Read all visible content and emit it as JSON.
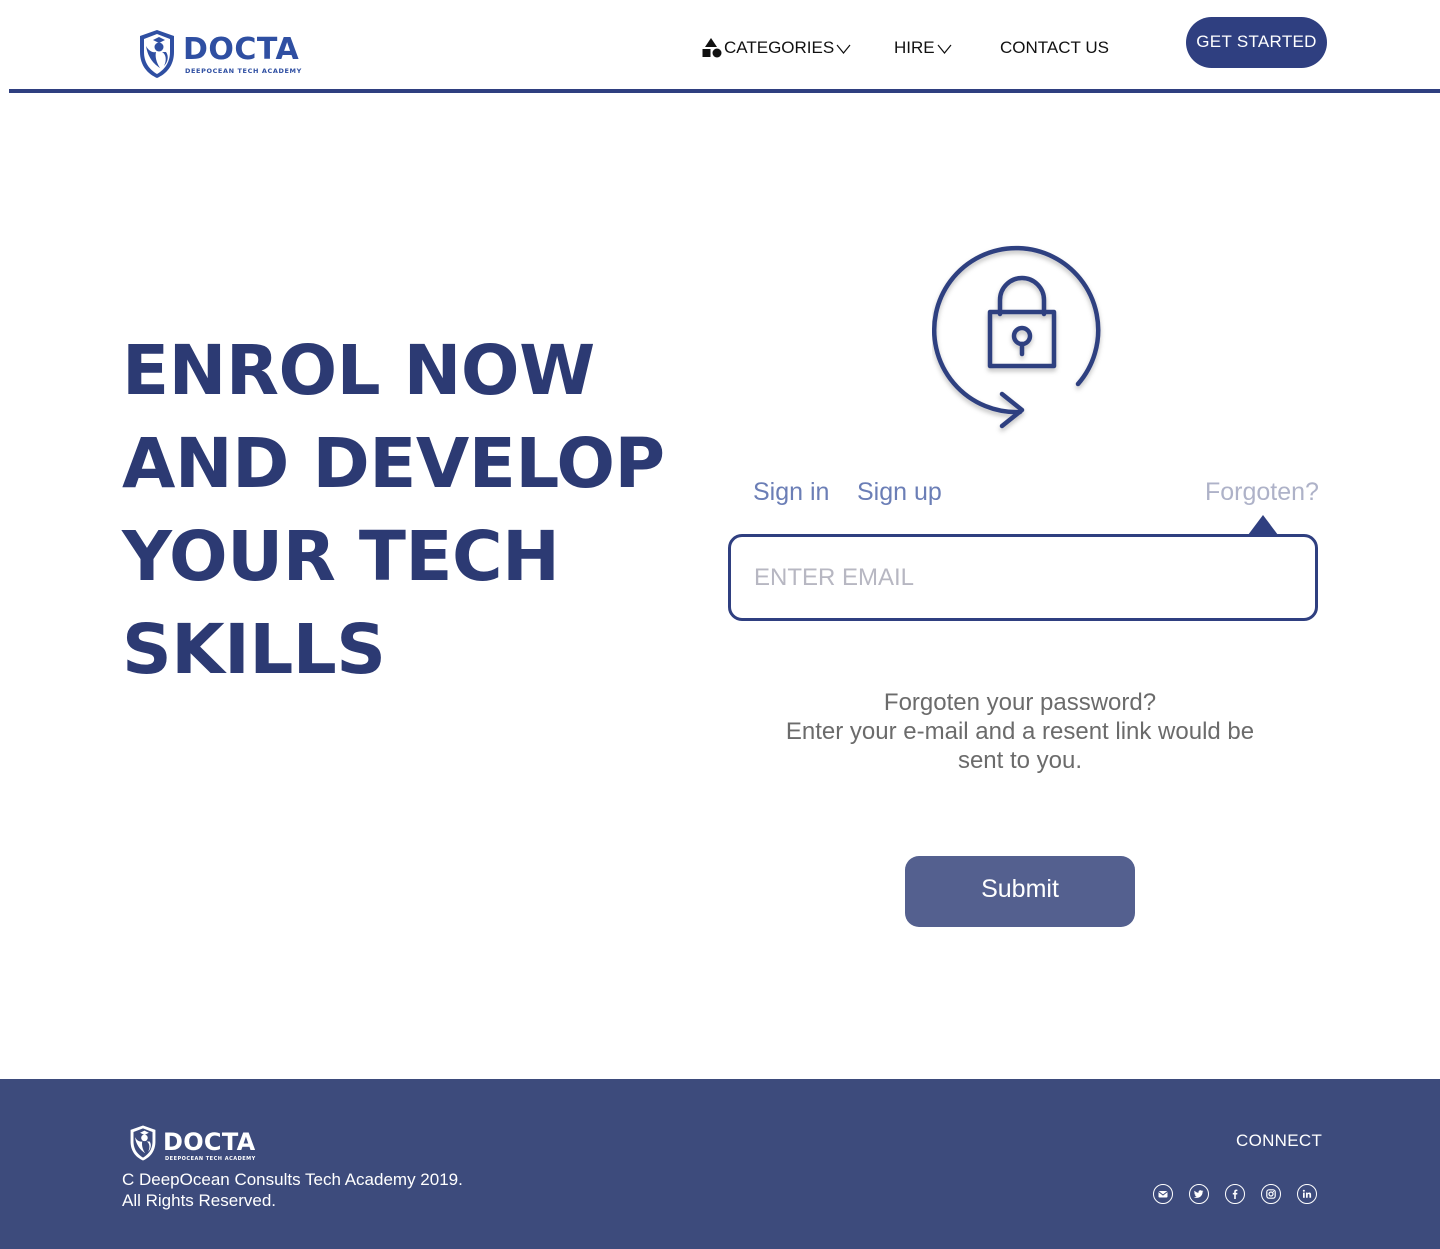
{
  "brand": {
    "name": "DOCTA",
    "tagline": "DEEPOCEAN TECH ACADEMY",
    "primary_color": "#2f3f80",
    "logo_color": "#2f4fa2",
    "footer_bg": "#3d4b7c"
  },
  "nav": {
    "categories": {
      "label": "CATEGORIES",
      "icon": "shapes-icon",
      "dropdown_icon": "chevron-down-icon"
    },
    "hire": {
      "label": "HIRE",
      "dropdown_icon": "chevron-down-icon"
    },
    "contact": {
      "label": "CONTACT US"
    },
    "cta": {
      "label": "GET STARTED"
    }
  },
  "hero": {
    "title_lines": [
      "ENROL NOW",
      "AND DEVELOP",
      "YOUR TECH",
      "SKILLS"
    ]
  },
  "auth": {
    "graphic_icon": "lock-reset-icon",
    "tabs": {
      "sign_in": "Sign in",
      "sign_up": "Sign up",
      "forgot": "Forgoten?"
    },
    "active_tab": "forgot",
    "email_placeholder": "ENTER EMAIL",
    "email_value": "",
    "help_lines": [
      "Forgoten your password?",
      "Enter your e-mail and a resent link would be sent to you."
    ],
    "submit_label": "Submit"
  },
  "footer": {
    "logo_name": "DOCTA",
    "logo_tagline": "DEEPOCEAN TECH ACADEMY",
    "copyright_lines": [
      "C DeepOcean Consults Tech Academy 2019.",
      "All Rights Reserved."
    ],
    "connect_label": "CONNECT",
    "socials": [
      "email-icon",
      "twitter-icon",
      "facebook-icon",
      "instagram-icon",
      "linkedin-icon"
    ]
  }
}
